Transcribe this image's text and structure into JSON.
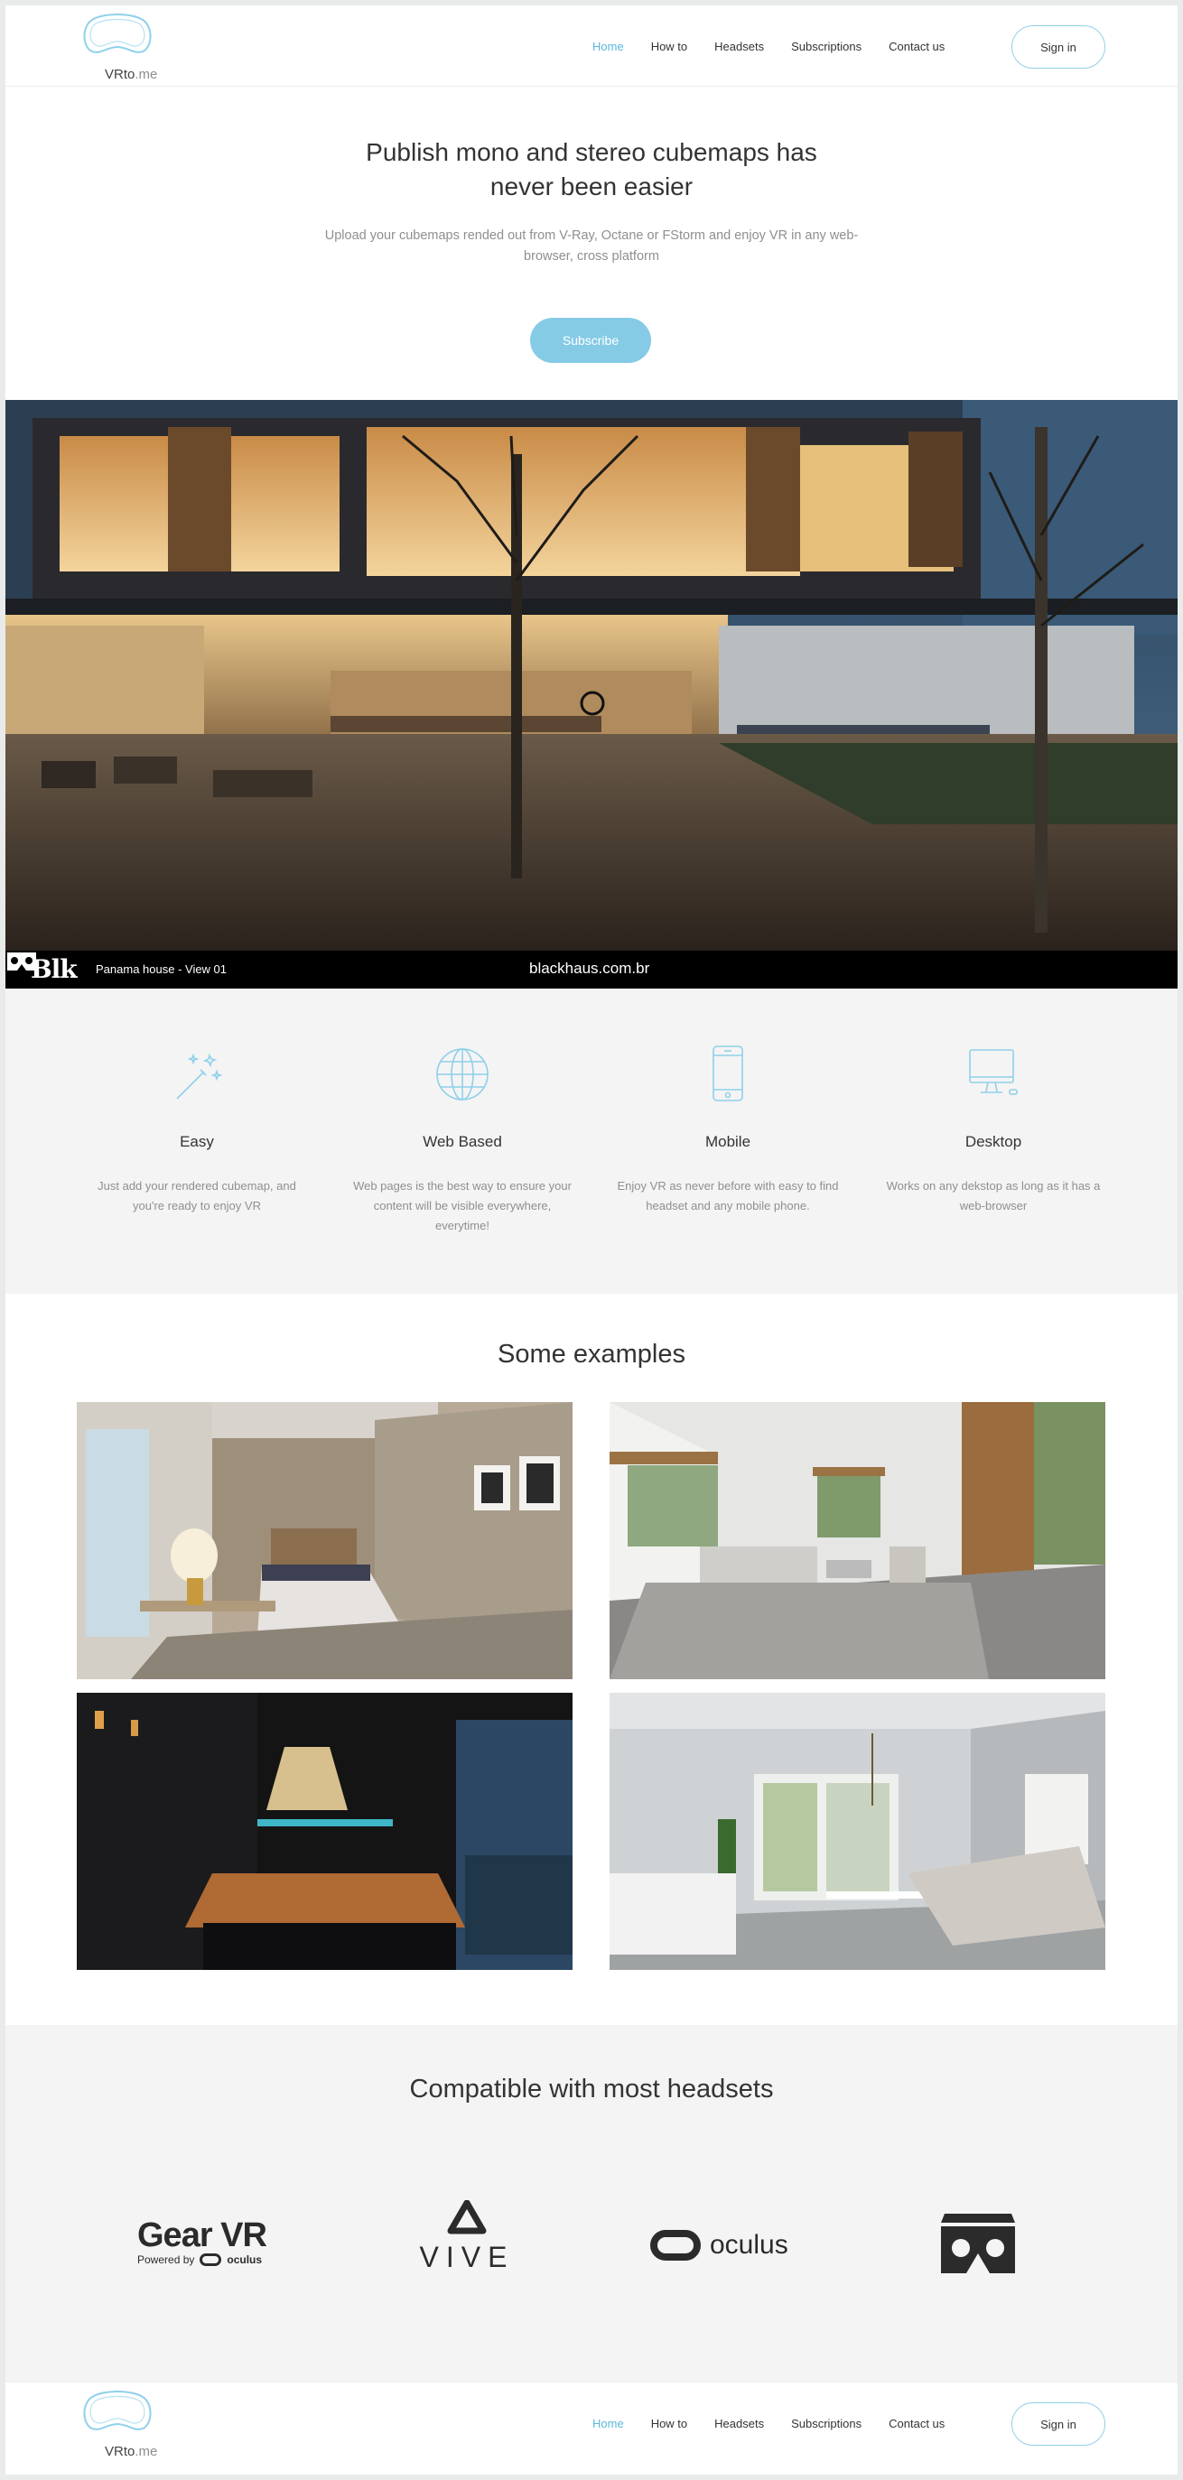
{
  "logo": {
    "name": "VRto",
    "suffix": ".me"
  },
  "nav": {
    "items": [
      {
        "label": "Home",
        "active": true
      },
      {
        "label": "How to",
        "active": false
      },
      {
        "label": "Headsets",
        "active": false
      },
      {
        "label": "Subscriptions",
        "active": false
      },
      {
        "label": "Contact us",
        "active": false
      }
    ],
    "signin": "Sign in"
  },
  "hero": {
    "title_line1": "Publish mono and stereo cubemaps has",
    "title_line2": "never been easier",
    "subtitle": "Upload your cubemaps rended out from V-Ray, Octane or FStorm and enjoy VR in any web-browser, cross platform",
    "cta": "Subscribe"
  },
  "viewer": {
    "brand": "Blk",
    "caption": "Panama house - View 01",
    "url": "blackhaus.com.br"
  },
  "features": [
    {
      "icon": "magic-wand-icon",
      "title": "Easy",
      "desc": "Just add your rendered cubemap, and you're ready to enjoy VR"
    },
    {
      "icon": "globe-icon",
      "title": "Web Based",
      "desc": "Web pages is the best way to ensure your content will be visible everywhere, everytime!"
    },
    {
      "icon": "mobile-phone-icon",
      "title": "Mobile",
      "desc": "Enjoy VR as never before with easy to find headset and any mobile phone."
    },
    {
      "icon": "desktop-icon",
      "title": "Desktop",
      "desc": "Works on any dekstop as long as it has a web-browser"
    }
  ],
  "examples": {
    "title": "Some examples"
  },
  "compatible": {
    "title": "Compatible with most headsets",
    "gearvr": {
      "main": "Gear VR",
      "powered": "Powered by",
      "oculus": "oculus"
    },
    "vive": "VIVE",
    "oculus": "oculus"
  },
  "colors": {
    "accent": "#5ab7dd",
    "button": "#85cbe6",
    "section_bg": "#f4f4f4"
  }
}
